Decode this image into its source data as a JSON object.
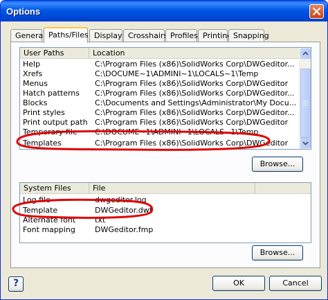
{
  "window": {
    "title": "Options"
  },
  "tabs": [
    {
      "label": "General"
    },
    {
      "label": "Paths/Files"
    },
    {
      "label": "Display"
    },
    {
      "label": "Crosshairs"
    },
    {
      "label": "Profiles"
    },
    {
      "label": "Printing"
    },
    {
      "label": "Snapping"
    }
  ],
  "user_paths": {
    "columns": [
      "User Paths",
      "Location"
    ],
    "rows": [
      {
        "name": "Help",
        "location": "C:\\Program Files (x86)\\SolidWorks Corp\\DWGeditor..."
      },
      {
        "name": "Xrefs",
        "location": "C:\\DOCUME~1\\ADMINI~1\\LOCALS~1\\Temp"
      },
      {
        "name": "Menus",
        "location": "C:\\Program Files (x86)\\SolidWorks Corp\\DWGeditor"
      },
      {
        "name": "Hatch patterns",
        "location": "C:\\Program Files (x86)\\SolidWorks Corp\\DWGeditor..."
      },
      {
        "name": "Blocks",
        "location": "C:\\Documents and Settings\\Administrator\\My Docu..."
      },
      {
        "name": "Print styles",
        "location": "C:\\Program Files (x86)\\SolidWorks Corp\\DWGeditor..."
      },
      {
        "name": "Print output path",
        "location": "C:\\Program Files (x86)\\SolidWorks Corp\\DWGeditor"
      },
      {
        "name": "Temporary file",
        "location": "C:\\DOCUME~1\\ADMINI~1\\LOCALS~1\\Temp"
      },
      {
        "name": "Templates",
        "location": "C:\\Program Files (x86)\\SolidWorks Corp\\DWGeditor"
      }
    ],
    "browse_label": "Browse..."
  },
  "system_files": {
    "columns": [
      "System Files",
      "File"
    ],
    "rows": [
      {
        "name": "Log file",
        "file": "dwgeditor.log"
      },
      {
        "name": "Template",
        "file": "DWGeditor.dwt"
      },
      {
        "name": "Alternate font",
        "file": "txt"
      },
      {
        "name": "Font mapping",
        "file": "DWGeditor.fmp"
      }
    ],
    "browse_label": "Browse..."
  },
  "footer": {
    "help_label": "?",
    "ok_label": "OK",
    "cancel_label": "Cancel"
  },
  "colors": {
    "title_bar": "#0054e3",
    "highlight_annotation": "#e00000",
    "active_tab_accent": "#ffc83c"
  },
  "icons": {
    "close": "close-icon",
    "scroll_up": "chevron-up-icon",
    "scroll_down": "chevron-down-icon"
  }
}
